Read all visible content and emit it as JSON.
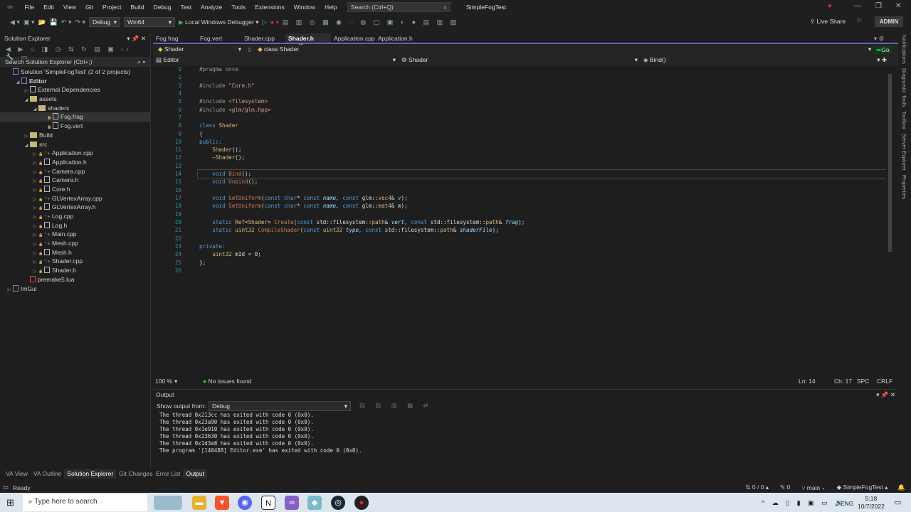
{
  "menu": {
    "items": [
      "File",
      "Edit",
      "View",
      "Git",
      "Project",
      "Build",
      "Debug",
      "Test",
      "Analyze",
      "Tools",
      "Extensions",
      "Window",
      "Help"
    ],
    "search_placeholder": "Search (Ctrl+Q)",
    "window_title": "SimpleFogTest"
  },
  "toolbar": {
    "config": "Debug",
    "platform": "Win64",
    "debugger": "Local Windows Debugger",
    "live_share": "Live Share",
    "account": "ADMIN"
  },
  "solution_explorer": {
    "title": "Solution Explorer",
    "search_placeholder": "Search Solution Explorer (Ctrl+;)",
    "items": [
      {
        "label": "Solution 'SimpleFogTest' (2 of 2 projects)",
        "depth": 0,
        "kind": "solution"
      },
      {
        "label": "Editor",
        "depth": 1,
        "kind": "project",
        "expanded": true
      },
      {
        "label": "External Dependencies",
        "depth": 2,
        "kind": "deps",
        "collapsed": true
      },
      {
        "label": "assets",
        "depth": 2,
        "kind": "folder",
        "expanded": true
      },
      {
        "label": "shaders",
        "depth": 3,
        "kind": "folder",
        "expanded": true
      },
      {
        "label": "Fog.frag",
        "depth": 4,
        "kind": "file",
        "selected": true
      },
      {
        "label": "Fog.vert",
        "depth": 4,
        "kind": "file"
      },
      {
        "label": "Build",
        "depth": 2,
        "kind": "folder",
        "collapsed": true
      },
      {
        "label": "src",
        "depth": 2,
        "kind": "folder",
        "expanded": true
      },
      {
        "label": "Application.cpp",
        "depth": 3,
        "kind": "cpp",
        "collapsed": true
      },
      {
        "label": "Application.h",
        "depth": 3,
        "kind": "h",
        "collapsed": true
      },
      {
        "label": "Camera.cpp",
        "depth": 3,
        "kind": "cpp",
        "collapsed": true
      },
      {
        "label": "Camera.h",
        "depth": 3,
        "kind": "h",
        "collapsed": true
      },
      {
        "label": "Core.h",
        "depth": 3,
        "kind": "h",
        "collapsed": true
      },
      {
        "label": "GLVertexArray.cpp",
        "depth": 3,
        "kind": "cpp",
        "collapsed": true
      },
      {
        "label": "GLVertexArray.h",
        "depth": 3,
        "kind": "h",
        "collapsed": true
      },
      {
        "label": "Log.cpp",
        "depth": 3,
        "kind": "cpp",
        "collapsed": true
      },
      {
        "label": "Log.h",
        "depth": 3,
        "kind": "h",
        "collapsed": true
      },
      {
        "label": "Main.cpp",
        "depth": 3,
        "kind": "cpp",
        "collapsed": true
      },
      {
        "label": "Mesh.cpp",
        "depth": 3,
        "kind": "cpp",
        "collapsed": true
      },
      {
        "label": "Mesh.h",
        "depth": 3,
        "kind": "h",
        "collapsed": true
      },
      {
        "label": "Shader.cpp",
        "depth": 3,
        "kind": "cpp",
        "collapsed": true
      },
      {
        "label": "Shader.h",
        "depth": 3,
        "kind": "h",
        "collapsed": true
      },
      {
        "label": "premake5.lua",
        "depth": 2,
        "kind": "lua"
      },
      {
        "label": "ImGui",
        "depth": 0,
        "kind": "project",
        "collapsed": true
      }
    ]
  },
  "editor": {
    "tabs": [
      "Fog.frag",
      "Fog.vert",
      "Shader.cpp",
      "Shader.h",
      "Application.cpp",
      "Application.h"
    ],
    "active_tab": "Shader.h",
    "nav_scope": "Shader",
    "nav_class": "class Shader",
    "nav_project": "Editor",
    "nav_type": "Shader",
    "nav_member": "Bind()",
    "go_label": "Go",
    "current_line": 14,
    "lines": [
      [
        [
          "#pragma once",
          "pre"
        ]
      ],
      [],
      [
        [
          "#include ",
          "pre"
        ],
        [
          "\"Core.h\"",
          "str"
        ]
      ],
      [],
      [
        [
          "#include ",
          "pre"
        ],
        [
          "<filesystem>",
          "str"
        ]
      ],
      [
        [
          "#include ",
          "pre"
        ],
        [
          "<glm/glm.hpp>",
          "str"
        ]
      ],
      [],
      [
        [
          "class ",
          "kw"
        ],
        [
          "Shader",
          "cls"
        ]
      ],
      [
        [
          "{",
          "def"
        ]
      ],
      [
        [
          "public:",
          "kw"
        ]
      ],
      [
        [
          "    Shader",
          "cls"
        ],
        [
          "();",
          "def"
        ]
      ],
      [
        [
          "    ~Shader",
          "cls"
        ],
        [
          "();",
          "def"
        ]
      ],
      [],
      [
        [
          "    void ",
          "kw"
        ],
        [
          "Bind",
          "fn"
        ],
        [
          "();",
          "def"
        ]
      ],
      [
        [
          "    void ",
          "kw"
        ],
        [
          "Unbind",
          "fn"
        ],
        [
          "();",
          "def"
        ]
      ],
      [],
      [
        [
          "    void ",
          "kw"
        ],
        [
          "SetUniform",
          "fn"
        ],
        [
          "(",
          "def"
        ],
        [
          "const char",
          "kw"
        ],
        [
          "* ",
          "def"
        ],
        [
          "const ",
          "kw"
        ],
        [
          "name, ",
          "par"
        ],
        [
          "const ",
          "kw"
        ],
        [
          "glm::",
          "def"
        ],
        [
          "vec4",
          "cls"
        ],
        [
          "& ",
          "def"
        ],
        [
          "v",
          "par"
        ],
        [
          ");",
          "def"
        ]
      ],
      [
        [
          "    void ",
          "kw"
        ],
        [
          "SetUniform",
          "fn"
        ],
        [
          "(",
          "def"
        ],
        [
          "const char",
          "kw"
        ],
        [
          "* ",
          "def"
        ],
        [
          "const ",
          "kw"
        ],
        [
          "name, ",
          "par"
        ],
        [
          "const ",
          "kw"
        ],
        [
          "glm::",
          "def"
        ],
        [
          "mat4",
          "cls"
        ],
        [
          "& ",
          "def"
        ],
        [
          "m",
          "par"
        ],
        [
          ");",
          "def"
        ]
      ],
      [],
      [
        [
          "    static ",
          "kw"
        ],
        [
          "Ref",
          "cls"
        ],
        [
          "<",
          "def"
        ],
        [
          "Shader",
          "cls"
        ],
        [
          "> ",
          "def"
        ],
        [
          "Create",
          "fn"
        ],
        [
          "(",
          "def"
        ],
        [
          "const ",
          "kw"
        ],
        [
          "std::filesystem::",
          "def"
        ],
        [
          "path",
          "cls"
        ],
        [
          "& ",
          "def"
        ],
        [
          "vert, ",
          "par"
        ],
        [
          "const ",
          "kw"
        ],
        [
          "std::filesystem::",
          "def"
        ],
        [
          "path",
          "cls"
        ],
        [
          "& ",
          "def"
        ],
        [
          "frag",
          "par"
        ],
        [
          ");",
          "def"
        ]
      ],
      [
        [
          "    static ",
          "kw"
        ],
        [
          "uint32 ",
          "cls"
        ],
        [
          "CompileShader",
          "fn"
        ],
        [
          "(",
          "def"
        ],
        [
          "const ",
          "kw"
        ],
        [
          "uint32 ",
          "cls"
        ],
        [
          "type, ",
          "par"
        ],
        [
          "const ",
          "kw"
        ],
        [
          "std::filesystem::",
          "def"
        ],
        [
          "path",
          "cls"
        ],
        [
          "& ",
          "def"
        ],
        [
          "shaderFile",
          "par"
        ],
        [
          ");",
          "def"
        ]
      ],
      [],
      [
        [
          "private:",
          "kw"
        ]
      ],
      [
        [
          "    uint32 ",
          "cls"
        ],
        [
          "mId = 0;",
          "def"
        ]
      ],
      [
        [
          "};",
          "def"
        ]
      ],
      []
    ],
    "zoom": "100 %",
    "issues": "No issues found",
    "ln": "Ln: 14",
    "ch": "Ch: 17",
    "spacing": "SPC",
    "eol": "CRLF"
  },
  "output": {
    "title": "Output",
    "show_from_label": "Show output from:",
    "source": "Debug",
    "lines": [
      "The thread 0x213cc has exited with code 0 (0x0).",
      "The thread 0x23a90 has exited with code 0 (0x0).",
      "The thread 0x1e910 has exited with code 0 (0x0).",
      "The thread 0x23630 has exited with code 0 (0x0).",
      "The thread 0x1d3e8 has exited with code 0 (0x0).",
      "The program '[140488] Editor.exe' has exited with code 0 (0x0)."
    ]
  },
  "left_tabs": [
    "VA View",
    "VA Outline",
    "Solution Explorer",
    "Git Changes"
  ],
  "bottom_tabs": [
    "Error List",
    "Output"
  ],
  "side_tabs": [
    "Notifications",
    "Diagnostic Tools",
    "Toolbox",
    "Server Explorer",
    "Properties"
  ],
  "statusbar": {
    "ready": "Ready",
    "changes": "0 / 0",
    "edits": "0",
    "branch": "main",
    "repo": "SimpleFogTest"
  },
  "taskbar": {
    "search_placeholder": "Type here to search",
    "lang": "ENG",
    "time": "5:18",
    "date": "10/7/2022"
  }
}
